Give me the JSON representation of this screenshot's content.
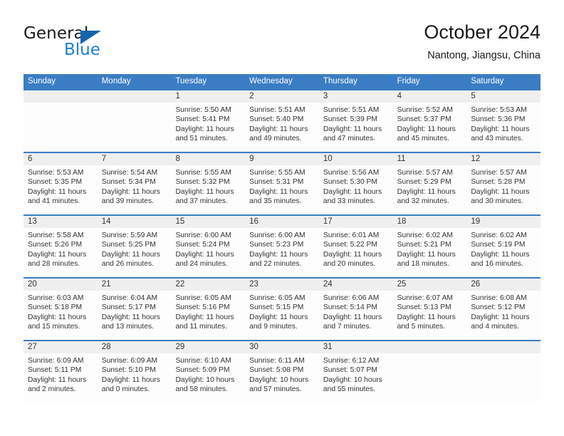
{
  "brand": {
    "name_part1": "General",
    "name_part2": "Blue",
    "triangle_icon": "triangle-icon",
    "colors": {
      "dark": "#1a1a1a",
      "blue": "#1f7fd0",
      "triangle": "#1265ac"
    }
  },
  "header": {
    "title": "October 2024",
    "subtitle": "Nantong, Jiangsu, China"
  },
  "theme": {
    "header_blue": "#3b7dc4",
    "daynum_band": "#efefef",
    "cell_bg": "#fdfdfd",
    "text": "#333333"
  },
  "weekdays": [
    "Sunday",
    "Monday",
    "Tuesday",
    "Wednesday",
    "Thursday",
    "Friday",
    "Saturday"
  ],
  "weeks": [
    {
      "days": [
        {
          "num": "",
          "sunrise": "",
          "sunset": "",
          "daylight_l1": "",
          "daylight_l2": ""
        },
        {
          "num": "",
          "sunrise": "",
          "sunset": "",
          "daylight_l1": "",
          "daylight_l2": ""
        },
        {
          "num": "1",
          "sunrise": "Sunrise: 5:50 AM",
          "sunset": "Sunset: 5:41 PM",
          "daylight_l1": "Daylight: 11 hours",
          "daylight_l2": "and 51 minutes."
        },
        {
          "num": "2",
          "sunrise": "Sunrise: 5:51 AM",
          "sunset": "Sunset: 5:40 PM",
          "daylight_l1": "Daylight: 11 hours",
          "daylight_l2": "and 49 minutes."
        },
        {
          "num": "3",
          "sunrise": "Sunrise: 5:51 AM",
          "sunset": "Sunset: 5:39 PM",
          "daylight_l1": "Daylight: 11 hours",
          "daylight_l2": "and 47 minutes."
        },
        {
          "num": "4",
          "sunrise": "Sunrise: 5:52 AM",
          "sunset": "Sunset: 5:37 PM",
          "daylight_l1": "Daylight: 11 hours",
          "daylight_l2": "and 45 minutes."
        },
        {
          "num": "5",
          "sunrise": "Sunrise: 5:53 AM",
          "sunset": "Sunset: 5:36 PM",
          "daylight_l1": "Daylight: 11 hours",
          "daylight_l2": "and 43 minutes."
        }
      ]
    },
    {
      "days": [
        {
          "num": "6",
          "sunrise": "Sunrise: 5:53 AM",
          "sunset": "Sunset: 5:35 PM",
          "daylight_l1": "Daylight: 11 hours",
          "daylight_l2": "and 41 minutes."
        },
        {
          "num": "7",
          "sunrise": "Sunrise: 5:54 AM",
          "sunset": "Sunset: 5:34 PM",
          "daylight_l1": "Daylight: 11 hours",
          "daylight_l2": "and 39 minutes."
        },
        {
          "num": "8",
          "sunrise": "Sunrise: 5:55 AM",
          "sunset": "Sunset: 5:32 PM",
          "daylight_l1": "Daylight: 11 hours",
          "daylight_l2": "and 37 minutes."
        },
        {
          "num": "9",
          "sunrise": "Sunrise: 5:55 AM",
          "sunset": "Sunset: 5:31 PM",
          "daylight_l1": "Daylight: 11 hours",
          "daylight_l2": "and 35 minutes."
        },
        {
          "num": "10",
          "sunrise": "Sunrise: 5:56 AM",
          "sunset": "Sunset: 5:30 PM",
          "daylight_l1": "Daylight: 11 hours",
          "daylight_l2": "and 33 minutes."
        },
        {
          "num": "11",
          "sunrise": "Sunrise: 5:57 AM",
          "sunset": "Sunset: 5:29 PM",
          "daylight_l1": "Daylight: 11 hours",
          "daylight_l2": "and 32 minutes."
        },
        {
          "num": "12",
          "sunrise": "Sunrise: 5:57 AM",
          "sunset": "Sunset: 5:28 PM",
          "daylight_l1": "Daylight: 11 hours",
          "daylight_l2": "and 30 minutes."
        }
      ]
    },
    {
      "days": [
        {
          "num": "13",
          "sunrise": "Sunrise: 5:58 AM",
          "sunset": "Sunset: 5:26 PM",
          "daylight_l1": "Daylight: 11 hours",
          "daylight_l2": "and 28 minutes."
        },
        {
          "num": "14",
          "sunrise": "Sunrise: 5:59 AM",
          "sunset": "Sunset: 5:25 PM",
          "daylight_l1": "Daylight: 11 hours",
          "daylight_l2": "and 26 minutes."
        },
        {
          "num": "15",
          "sunrise": "Sunrise: 6:00 AM",
          "sunset": "Sunset: 5:24 PM",
          "daylight_l1": "Daylight: 11 hours",
          "daylight_l2": "and 24 minutes."
        },
        {
          "num": "16",
          "sunrise": "Sunrise: 6:00 AM",
          "sunset": "Sunset: 5:23 PM",
          "daylight_l1": "Daylight: 11 hours",
          "daylight_l2": "and 22 minutes."
        },
        {
          "num": "17",
          "sunrise": "Sunrise: 6:01 AM",
          "sunset": "Sunset: 5:22 PM",
          "daylight_l1": "Daylight: 11 hours",
          "daylight_l2": "and 20 minutes."
        },
        {
          "num": "18",
          "sunrise": "Sunrise: 6:02 AM",
          "sunset": "Sunset: 5:21 PM",
          "daylight_l1": "Daylight: 11 hours",
          "daylight_l2": "and 18 minutes."
        },
        {
          "num": "19",
          "sunrise": "Sunrise: 6:02 AM",
          "sunset": "Sunset: 5:19 PM",
          "daylight_l1": "Daylight: 11 hours",
          "daylight_l2": "and 16 minutes."
        }
      ]
    },
    {
      "days": [
        {
          "num": "20",
          "sunrise": "Sunrise: 6:03 AM",
          "sunset": "Sunset: 5:18 PM",
          "daylight_l1": "Daylight: 11 hours",
          "daylight_l2": "and 15 minutes."
        },
        {
          "num": "21",
          "sunrise": "Sunrise: 6:04 AM",
          "sunset": "Sunset: 5:17 PM",
          "daylight_l1": "Daylight: 11 hours",
          "daylight_l2": "and 13 minutes."
        },
        {
          "num": "22",
          "sunrise": "Sunrise: 6:05 AM",
          "sunset": "Sunset: 5:16 PM",
          "daylight_l1": "Daylight: 11 hours",
          "daylight_l2": "and 11 minutes."
        },
        {
          "num": "23",
          "sunrise": "Sunrise: 6:05 AM",
          "sunset": "Sunset: 5:15 PM",
          "daylight_l1": "Daylight: 11 hours",
          "daylight_l2": "and 9 minutes."
        },
        {
          "num": "24",
          "sunrise": "Sunrise: 6:06 AM",
          "sunset": "Sunset: 5:14 PM",
          "daylight_l1": "Daylight: 11 hours",
          "daylight_l2": "and 7 minutes."
        },
        {
          "num": "25",
          "sunrise": "Sunrise: 6:07 AM",
          "sunset": "Sunset: 5:13 PM",
          "daylight_l1": "Daylight: 11 hours",
          "daylight_l2": "and 5 minutes."
        },
        {
          "num": "26",
          "sunrise": "Sunrise: 6:08 AM",
          "sunset": "Sunset: 5:12 PM",
          "daylight_l1": "Daylight: 11 hours",
          "daylight_l2": "and 4 minutes."
        }
      ]
    },
    {
      "days": [
        {
          "num": "27",
          "sunrise": "Sunrise: 6:09 AM",
          "sunset": "Sunset: 5:11 PM",
          "daylight_l1": "Daylight: 11 hours",
          "daylight_l2": "and 2 minutes."
        },
        {
          "num": "28",
          "sunrise": "Sunrise: 6:09 AM",
          "sunset": "Sunset: 5:10 PM",
          "daylight_l1": "Daylight: 11 hours",
          "daylight_l2": "and 0 minutes."
        },
        {
          "num": "29",
          "sunrise": "Sunrise: 6:10 AM",
          "sunset": "Sunset: 5:09 PM",
          "daylight_l1": "Daylight: 10 hours",
          "daylight_l2": "and 58 minutes."
        },
        {
          "num": "30",
          "sunrise": "Sunrise: 6:11 AM",
          "sunset": "Sunset: 5:08 PM",
          "daylight_l1": "Daylight: 10 hours",
          "daylight_l2": "and 57 minutes."
        },
        {
          "num": "31",
          "sunrise": "Sunrise: 6:12 AM",
          "sunset": "Sunset: 5:07 PM",
          "daylight_l1": "Daylight: 10 hours",
          "daylight_l2": "and 55 minutes."
        },
        {
          "num": "",
          "sunrise": "",
          "sunset": "",
          "daylight_l1": "",
          "daylight_l2": ""
        },
        {
          "num": "",
          "sunrise": "",
          "sunset": "",
          "daylight_l1": "",
          "daylight_l2": ""
        }
      ]
    }
  ]
}
